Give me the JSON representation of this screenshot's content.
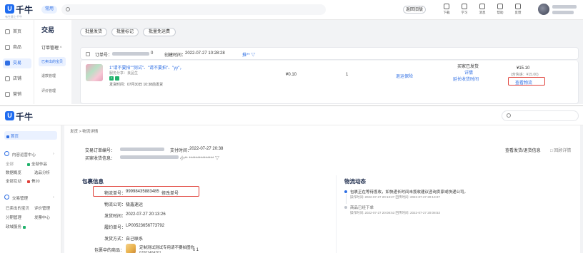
{
  "panel1": {
    "logo": {
      "mark": "U",
      "text": "千牛",
      "slogan": "有生意上千牛"
    },
    "topbar": {
      "pill": "常用",
      "back_button": "返回旧版",
      "icons": [
        {
          "name": "download-icon",
          "label": "下载"
        },
        {
          "name": "study-icon",
          "label": "学习"
        },
        {
          "name": "message-icon",
          "label": "消息"
        },
        {
          "name": "help-icon",
          "label": "帮助"
        },
        {
          "name": "feedback-icon",
          "label": "反馈"
        }
      ]
    },
    "nav": [
      {
        "label": "首页",
        "icon": "home-icon",
        "active": false
      },
      {
        "label": "商品",
        "icon": "goods-icon",
        "active": false
      },
      {
        "label": "交易",
        "icon": "trade-icon",
        "active": true
      },
      {
        "label": "店铺",
        "icon": "shop-icon",
        "active": false
      },
      {
        "label": "营销",
        "icon": "marketing-icon",
        "active": false
      }
    ],
    "subnav": {
      "title": "交易",
      "group": "订单管理",
      "group_caret": "^",
      "items": [
        "已卖出的宝贝",
        "退款管理",
        "评价管理"
      ]
    },
    "actions": [
      "批量发货",
      "批量标记",
      "批量免运费"
    ],
    "order": {
      "order_no_label": "订单号：",
      "order_no_tail": "0",
      "created_label": "创建时间：",
      "created_time": "2022-07-27 10:28:28",
      "flag": "推** ▽",
      "title": "1\"请不要拍\"\"测试\"、\"请不要拍\"、\"yy\"，",
      "spec": "服务分享：良品生",
      "tag": "7",
      "ship_time": "发货时间：07月30日 10:38前发货",
      "price": "¥0.10",
      "qty": "1",
      "refund_link": "退运保险",
      "status": "买家已发货",
      "detail_link": "详情",
      "extend_link": "延长收货时间",
      "total": "¥15.10",
      "total_note": "(含快递：¥15.00)",
      "view_logistics": "查看物流"
    }
  },
  "panel2": {
    "logo": {
      "mark": "U",
      "text": "千牛"
    },
    "nav": {
      "home": "首页",
      "content_center": "内容运营中心",
      "content_items": [
        "全部作品",
        "数据概览",
        "选品分析",
        "全部互动",
        "骨20"
      ],
      "trade_mgmt": "交易管理",
      "trade_items": [
        "已卖出的宝贝",
        "评价管理",
        "分期管理",
        "发票中心",
        "政域服务"
      ]
    },
    "breadcrumb": {
      "root": "发货",
      "sep": ">",
      "current": "物流详情"
    },
    "order_info": {
      "order_no_label": "交易订单编号：",
      "pay_time_label": "支付时间：",
      "pay_time": "2022-07-27 20:38",
      "buyer_addr_label": "买家收货信息：",
      "buyer_addr_tail": "小** *************** ▽",
      "view_link": "查看发货/退货信息",
      "back_link": "□ 回顾详情"
    },
    "package": {
      "title": "包裹信息",
      "tracking_label": "物流单号：",
      "tracking_no": "99998435883485",
      "modify_link": "修改单号",
      "company_label": "物流公司：",
      "company": "极鑫速运",
      "ship_time_label": "发货时间：",
      "ship_time": "2022-07-27 20:13:26",
      "contract_label": "履约单号：",
      "contract": "LP00523656773792",
      "method_label": "发货方式：",
      "method": "自己联系",
      "items_label": "包裹中的商品：",
      "item_name": "定制测试测试专用请不要拍图你",
      "item_id": "67001404761",
      "item_qty": "x 1"
    },
    "logistics": {
      "title": "物流动态",
      "events": [
        {
          "text": "包裹正在等待揽收，如快递长时间未揽收建议咨询卖家或快递公司。",
          "meta": "操作时间: 2022-07-27 20:13:27   回传时间: 2022-07-27 20:13:27",
          "color": "#2f6fe4"
        },
        {
          "text": "商品已经下单",
          "meta": "操作时间: 2022-07-27 20:08:53   回传时间: 2022-07-27 20:08:53",
          "color": "#bfc4cc"
        }
      ]
    },
    "search_icon": "search-icon"
  },
  "colors": {
    "accent": "#2f6fe4",
    "highlight": "#e0413a",
    "success": "#20b26c"
  }
}
